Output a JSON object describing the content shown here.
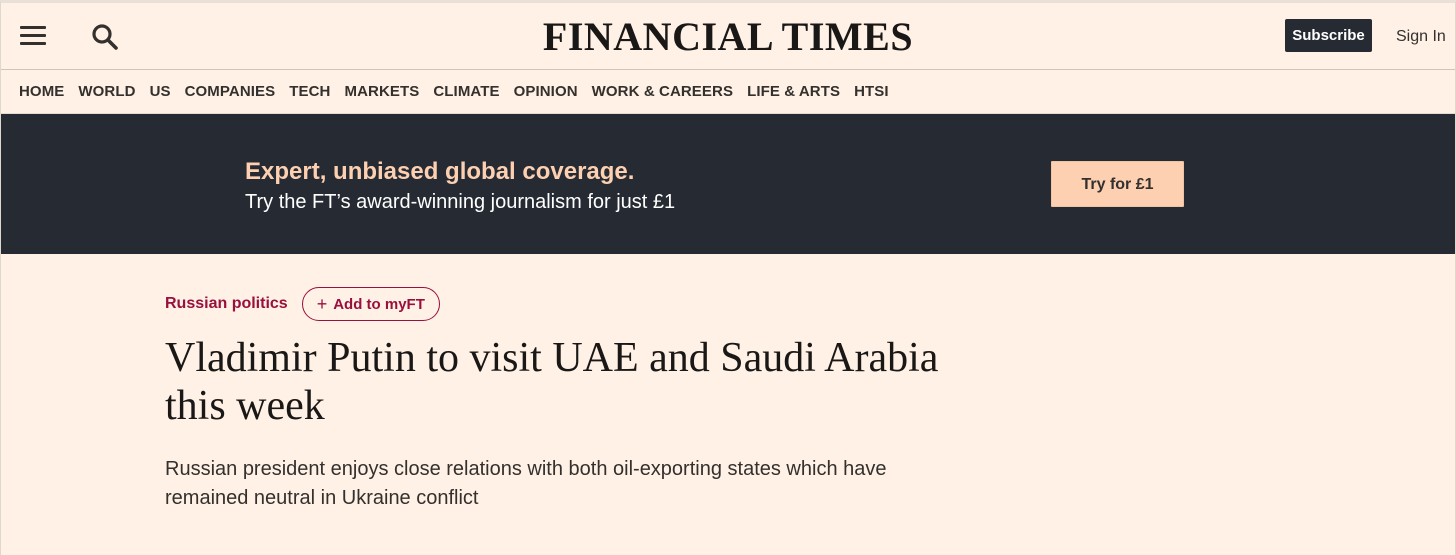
{
  "header": {
    "brand": "FINANCIAL TIMES",
    "subscribe_label": "Subscribe",
    "signin_label": "Sign In",
    "menu_icon": "hamburger-menu-icon",
    "search_icon": "search-icon"
  },
  "nav": {
    "items": [
      "HOME",
      "WORLD",
      "US",
      "COMPANIES",
      "TECH",
      "MARKETS",
      "CLIMATE",
      "OPINION",
      "WORK & CAREERS",
      "LIFE & ARTS",
      "HTSI"
    ]
  },
  "promo": {
    "headline": "Expert, unbiased global coverage.",
    "subtext": "Try the FT’s award-winning journalism for just £1",
    "cta_label": "Try for £1"
  },
  "article": {
    "topic": "Russian politics",
    "myft_label": "Add to myFT",
    "headline": "Vladimir Putin to visit UAE and Saudi Arabia this week",
    "standfirst": "Russian president enjoys close relations with both oil-exporting states which have remained neutral in Ukraine conflict"
  },
  "colors": {
    "background": "#fff1e5",
    "dark": "#262a33",
    "accent": "#990f3d",
    "promo_accent": "#fcd0b1"
  }
}
